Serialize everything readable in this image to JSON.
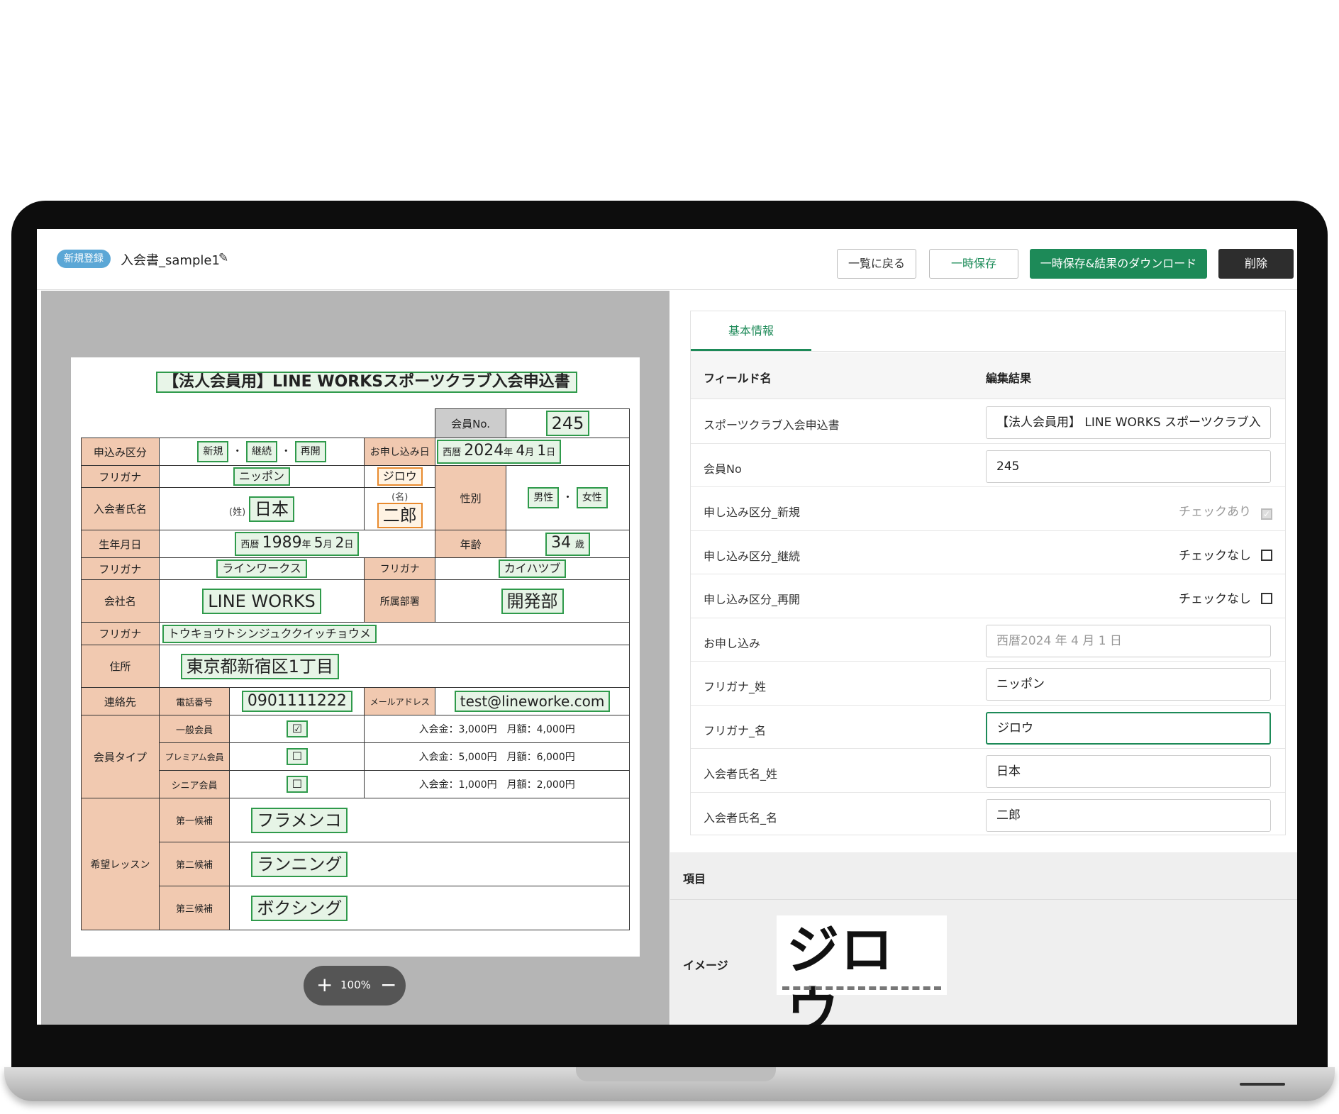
{
  "header": {
    "badge": "新規登録",
    "doc_title": "入会書_sample1",
    "buttons": {
      "back": "一覧に戻る",
      "temp_save": "一時保存",
      "save_download": "一時保存&結果のダウンロード",
      "delete": "削除"
    }
  },
  "viewer": {
    "zoom_plus": "+",
    "zoom_level": "100%",
    "zoom_minus": "−"
  },
  "form": {
    "title": "【法人会員用】LINE WORKSスポーツクラブ入会申込書",
    "member_no_label": "会員No.",
    "member_no": "245",
    "apply_type_label": "申込み区分",
    "apply_new": "新規",
    "apply_continue": "継続",
    "apply_resume": "再開",
    "dot": "・",
    "apply_date_label": "お申し込み日",
    "era": "西暦",
    "apply_year": "2024",
    "year_unit": "年",
    "apply_month": "4",
    "month_unit": "月",
    "apply_day": "1",
    "day_unit": "日",
    "furigana_label": "フリガナ",
    "furigana_sei": "ニッポン",
    "furigana_mei": "ジロウ",
    "name_label": "入会者氏名",
    "sei_mark": "(姓)",
    "mei_mark": "(名)",
    "name_sei": "日本",
    "name_mei": "二郎",
    "gender_label": "性別",
    "gender_male": "男性",
    "gender_female": "女性",
    "birth_label": "生年月日",
    "birth_year": "1989",
    "birth_month": "5",
    "birth_day": "2",
    "age_label": "年齢",
    "age": "34",
    "age_unit": "歳",
    "company_kana": "ラインワークス",
    "dept_kana_label": "フリガナ",
    "dept_kana": "カイハツブ",
    "company_label": "会社名",
    "company": "LINE WORKS",
    "dept_label": "所属部署",
    "dept": "開発部",
    "address_kana": "トウキョウトシンジュククイッチョウメ",
    "address_label": "住所",
    "address": "東京都新宿区1丁目",
    "contact_label": "連絡先",
    "phone_label": "電話番号",
    "phone": "0901111222",
    "mail_label": "メールアドレス",
    "mail": "test@lineworke.com",
    "member_type_label": "会員タイプ",
    "types": [
      {
        "name": "一般会員",
        "mark": "☑",
        "fee": "入会金：3,000円　月額：4,000円"
      },
      {
        "name": "プレミアム会員",
        "mark": "☐",
        "fee": "入会金：5,000円　月額：6,000円"
      },
      {
        "name": "シニア会員",
        "mark": "☐",
        "fee": "入会金：1,000円　月額：2,000円"
      }
    ],
    "lesson_label": "希望レッスン",
    "lessons": [
      {
        "rank": "第一候補",
        "value": "フラメンコ"
      },
      {
        "rank": "第二候補",
        "value": "ランニング"
      },
      {
        "rank": "第三候補",
        "value": "ボクシング"
      }
    ]
  },
  "panel": {
    "tab": "基本情報",
    "col_field": "フィールド名",
    "col_result": "編集結果",
    "rows": [
      {
        "field": "スポーツクラブ入会申込書",
        "value": "【法人会員用】 LINE WORKS スポーツクラブ入"
      },
      {
        "field": "会員No",
        "value": "245"
      },
      {
        "field": "申し込み区分_新規",
        "value": "チェックあり"
      },
      {
        "field": "申し込み区分_継続",
        "value": "チェックなし"
      },
      {
        "field": "申し込み区分_再開",
        "value": "チェックなし"
      },
      {
        "field": "お申し込み",
        "value": "西暦2024 年 4 月 1 日"
      },
      {
        "field": "フリガナ_姓",
        "value": "ニッポン"
      },
      {
        "field": "フリガナ_名",
        "value": "ジロウ"
      },
      {
        "field": "入会者氏名_姓",
        "value": "日本"
      },
      {
        "field": "入会者氏名_名",
        "value": "二郎"
      }
    ],
    "item_heading": "項目",
    "image_label": "イメージ",
    "image_text": "ジロウ"
  }
}
